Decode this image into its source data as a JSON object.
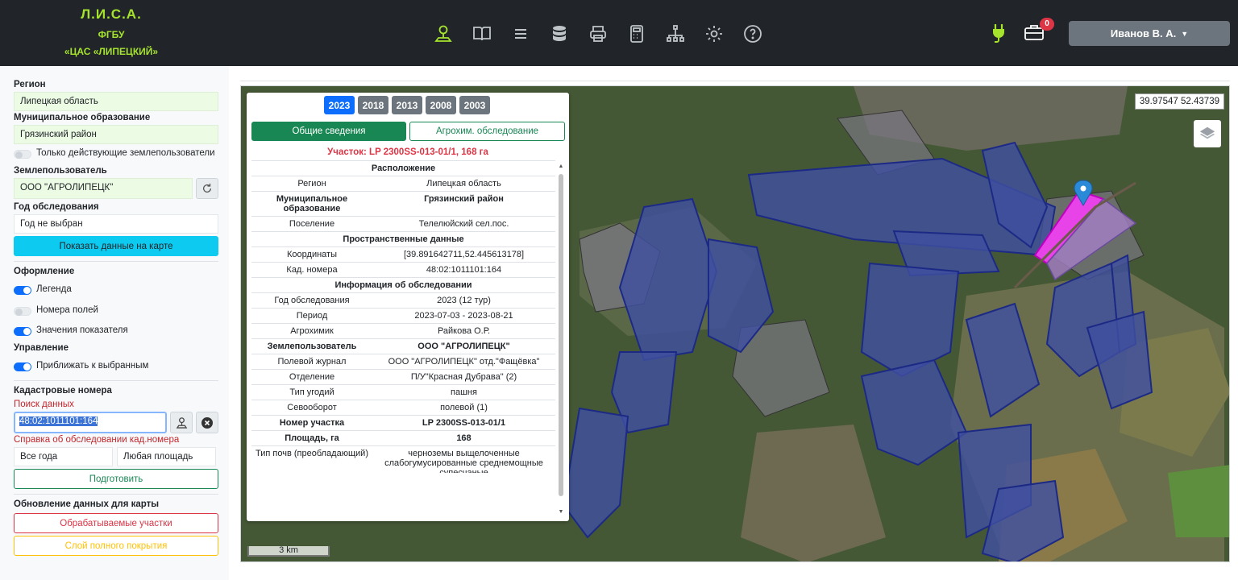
{
  "brand": {
    "title": "Л.И.С.А.",
    "line2": "ФГБУ",
    "line3": "«ЦАС «ЛИПЕЦКИЙ»"
  },
  "nav_icons": [
    "map-pin-icon",
    "book-icon",
    "list-icon",
    "database-icon",
    "printer-icon",
    "calculator-icon",
    "sitemap-icon",
    "gear-icon",
    "help-icon"
  ],
  "header": {
    "notifications_count": "0",
    "user_name": "Иванов В. А."
  },
  "sidebar": {
    "region_label": "Регион",
    "region_value": "Липецкая область",
    "municipality_label": "Муниципальное образование",
    "municipality_value": "Грязинский район",
    "active_users_toggle": "Только действующие землепользователи",
    "land_user_label": "Землепользователь",
    "land_user_value": "ООО \"АГРОЛИПЕЦК\"",
    "survey_year_label": "Год обследования",
    "survey_year_value": "Год не выбран",
    "show_on_map_button": "Показать данные на карте",
    "design_label": "Оформление",
    "legend_toggle": "Легенда",
    "field_numbers_toggle": "Номера полей",
    "indicator_values_toggle": "Значения показателя",
    "control_label": "Управление",
    "zoom_selected_toggle": "Приближать к выбранным",
    "cadastral_label": "Кадастровые номера",
    "search_label": "Поиск данных",
    "search_value": "48:02:1011101:164",
    "reference_label": "Справка об обследовании кад.номера",
    "all_years": "Все года",
    "any_area": "Любая площадь",
    "prepare_button": "Подготовить",
    "update_label": "Обновление данных для карты",
    "processed_button": "Обрабатываемые участки",
    "full_coverage_button": "Слой полного покрытия"
  },
  "map": {
    "coords": "39.97547 52.43739",
    "scale": "3 km"
  },
  "popup": {
    "years": [
      "2023",
      "2018",
      "2013",
      "2008",
      "2003"
    ],
    "active_year": "2023",
    "tab_general": "Общие сведения",
    "tab_agrochem": "Агрохим. обследование",
    "parcel_title": "Участок: LP 2300SS-013-01/1, 168 га",
    "sec_location": "Расположение",
    "region_k": "Регион",
    "region_v": "Липецкая область",
    "muni_k": "Муниципальное образование",
    "muni_v": "Грязинский район",
    "settlement_k": "Поселение",
    "settlement_v": "Телелюйский сел.пос.",
    "sec_spatial": "Пространственные данные",
    "coords_k": "Координаты",
    "coords_v": "[39.891642711,52.445613178]",
    "cad_k": "Кад. номера",
    "cad_v": "48:02:1011101:164",
    "sec_survey": "Информация об обследовании",
    "year_k": "Год обследования",
    "year_v": "2023 (12 тур)",
    "period_k": "Период",
    "period_v": "2023-07-03 - 2023-08-21",
    "agrochemist_k": "Агрохимик",
    "agrochemist_v": "Райкова О.Р.",
    "landuser_k": "Землепользователь",
    "landuser_v": "ООО \"АГРОЛИПЕЦК\"",
    "journal_k": "Полевой журнал",
    "journal_v": "ООО \"АГРОЛИПЕЦК\" отд.\"Фащёвка\"",
    "dept_k": "Отделение",
    "dept_v": "П/У\"Красная Дубрава\" (2)",
    "landtype_k": "Тип угодий",
    "landtype_v": "пашня",
    "rotation_k": "Севооборот",
    "rotation_v": "полевой (1)",
    "plot_k": "Номер участка",
    "plot_v": "LP 2300SS-013-01/1",
    "area_k": "Площадь, га",
    "area_v": "168",
    "soil_k": "Тип почв (преобладающий)",
    "soil_v": "черноземы выщелоченные слабогумусированные среднемощные супесчаные"
  }
}
